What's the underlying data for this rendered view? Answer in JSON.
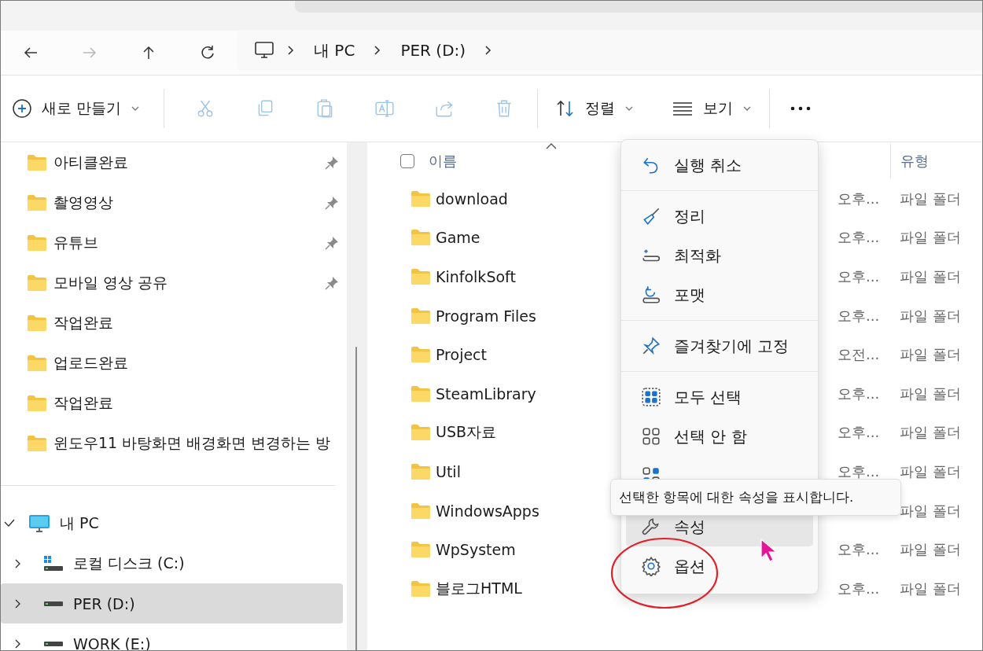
{
  "nav": {
    "buttons": [
      {
        "kind": "back",
        "disabled": false
      },
      {
        "kind": "forward",
        "disabled": true
      },
      {
        "kind": "up",
        "disabled": false
      },
      {
        "kind": "refresh",
        "disabled": false
      }
    ],
    "breadcrumb": [
      "내 PC",
      "PER (D:)"
    ]
  },
  "toolbar": {
    "new_label": "새로 만들기",
    "actions": [
      {
        "kind": "cut",
        "disabled": true
      },
      {
        "kind": "copy",
        "disabled": true
      },
      {
        "kind": "paste",
        "disabled": true
      },
      {
        "kind": "rename",
        "disabled": true
      },
      {
        "kind": "share",
        "disabled": true
      },
      {
        "kind": "delete",
        "disabled": true
      }
    ],
    "sort_label": "정렬",
    "view_label": "보기"
  },
  "sidebar": {
    "quick_access": [
      {
        "label": "아티클완료",
        "pinned": true
      },
      {
        "label": "촬영영상",
        "pinned": true
      },
      {
        "label": "유튜브",
        "pinned": true
      },
      {
        "label": "모바일 영상 공유",
        "pinned": true
      },
      {
        "label": "작업완료",
        "pinned": false
      },
      {
        "label": "업로드완료",
        "pinned": false
      },
      {
        "label": "작업완료",
        "pinned": false
      },
      {
        "label": "윈도우11 바탕화면 배경화면 변경하는 방",
        "pinned": false
      }
    ],
    "tree": [
      {
        "label": "내 PC",
        "kind": "pc",
        "expanded": true,
        "selected": false,
        "children": [
          {
            "label": "로컬 디스크 (C:)",
            "kind": "system-drive",
            "expanded": false,
            "selected": false
          },
          {
            "label": "PER (D:)",
            "kind": "drive",
            "expanded": false,
            "selected": true
          },
          {
            "label": "WORK (E:)",
            "kind": "drive",
            "expanded": false,
            "selected": false
          }
        ]
      }
    ]
  },
  "file_list": {
    "select_all_checked": false,
    "columns": [
      {
        "label": "이름"
      },
      {
        "label": "유형"
      }
    ],
    "rows": [
      {
        "name": "download",
        "date": "오후...",
        "type": "파일 폴더"
      },
      {
        "name": "Game",
        "date": "오후...",
        "type": "파일 폴더"
      },
      {
        "name": "KinfolkSoft",
        "date": "오후...",
        "type": "파일 폴더"
      },
      {
        "name": "Program Files",
        "date": "오후...",
        "type": "파일 폴더"
      },
      {
        "name": "Project",
        "date": "오전...",
        "type": "파일 폴더"
      },
      {
        "name": "SteamLibrary",
        "date": "오후...",
        "type": "파일 폴더"
      },
      {
        "name": "USB자료",
        "date": "오후...",
        "type": "파일 폴더"
      },
      {
        "name": "Util",
        "date": "오후...",
        "type": "파일 폴더"
      },
      {
        "name": "WindowsApps",
        "type": "파일 폴더"
      },
      {
        "name": "WpSystem",
        "date": "오후...",
        "type": "파일 폴더"
      },
      {
        "name": "블로그HTML",
        "date": "오후...",
        "type": "파일 폴더"
      }
    ]
  },
  "context_menu": {
    "groups": [
      [
        {
          "label": "실행 취소",
          "hovered": false
        }
      ],
      [
        {
          "label": "정리",
          "hovered": false
        },
        {
          "label": "최적화",
          "hovered": false
        },
        {
          "label": "포맷",
          "hovered": false
        }
      ],
      [
        {
          "label": "즐겨찾기에 고정",
          "hovered": false
        }
      ],
      [
        {
          "label": "모두 선택",
          "hovered": false
        },
        {
          "label": "선택 안 함",
          "hovered": false
        },
        {
          "hovered": false
        }
      ],
      [
        {
          "label": "속성",
          "hovered": true
        },
        {
          "label": "옵션",
          "hovered": false
        }
      ]
    ]
  },
  "tooltip": "선택한 항목에 대한 속성을 표시합니다."
}
